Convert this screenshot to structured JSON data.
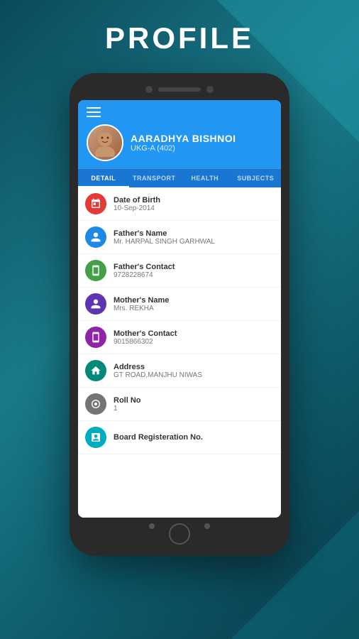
{
  "page": {
    "title": "PROFILE"
  },
  "student": {
    "name": "AARADHYA BISHNOI",
    "class": "UKG-A (402)"
  },
  "tabs": [
    {
      "label": "DETAIL",
      "active": true
    },
    {
      "label": "TRANSPORT",
      "active": false
    },
    {
      "label": "HEALTH",
      "active": false
    },
    {
      "label": "SUBJECTS",
      "active": false
    }
  ],
  "details": [
    {
      "label": "Date of Birth",
      "value": "10-Sep-2014",
      "icon_color": "red",
      "icon_type": "calendar"
    },
    {
      "label": "Father's Name",
      "value": "Mr. HARPAL SINGH GARHWAL",
      "icon_color": "blue",
      "icon_type": "person"
    },
    {
      "label": "Father's Contact",
      "value": "9728228674",
      "icon_color": "green",
      "icon_type": "phone"
    },
    {
      "label": "Mother's Name",
      "value": "Mrs. REKHA",
      "icon_color": "purple-dark",
      "icon_type": "person"
    },
    {
      "label": "Mother's Contact",
      "value": "9015866302",
      "icon_color": "purple",
      "icon_type": "phone"
    },
    {
      "label": "Address",
      "value": "GT ROAD,MANJHU NIWAS",
      "icon_color": "teal",
      "icon_type": "home"
    },
    {
      "label": "Roll No",
      "value": "1",
      "icon_color": "gray",
      "icon_type": "badge"
    },
    {
      "label": "Board Registeration No.",
      "value": "",
      "icon_color": "cyan",
      "icon_type": "clipboard"
    }
  ],
  "colors": {
    "background_top": "#0a4a5a",
    "header_blue": "#2196F3",
    "tab_blue": "#1976D2"
  }
}
